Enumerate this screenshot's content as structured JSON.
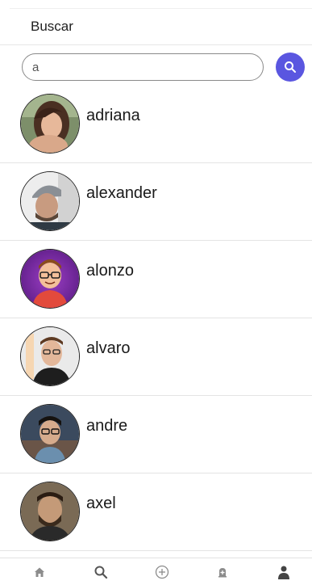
{
  "header": {
    "title": "Buscar"
  },
  "search": {
    "value": "a",
    "button_icon": "search-icon",
    "button_color": "#5a56e0"
  },
  "users": [
    {
      "name": "adriana",
      "avatar": "avatar-photo"
    },
    {
      "name": "alexander",
      "avatar": "avatar-photo"
    },
    {
      "name": "alonzo",
      "avatar": "avatar-cartoon"
    },
    {
      "name": "alvaro",
      "avatar": "avatar-photo"
    },
    {
      "name": "andre",
      "avatar": "avatar-photo"
    },
    {
      "name": "axel",
      "avatar": "avatar-photo"
    }
  ],
  "bottom_nav": {
    "items": [
      {
        "icon": "home-icon"
      },
      {
        "icon": "search-icon"
      },
      {
        "icon": "add-circle-icon"
      },
      {
        "icon": "notifications-icon"
      },
      {
        "icon": "profile-icon"
      }
    ],
    "icon_color": "#8c8c8c"
  }
}
